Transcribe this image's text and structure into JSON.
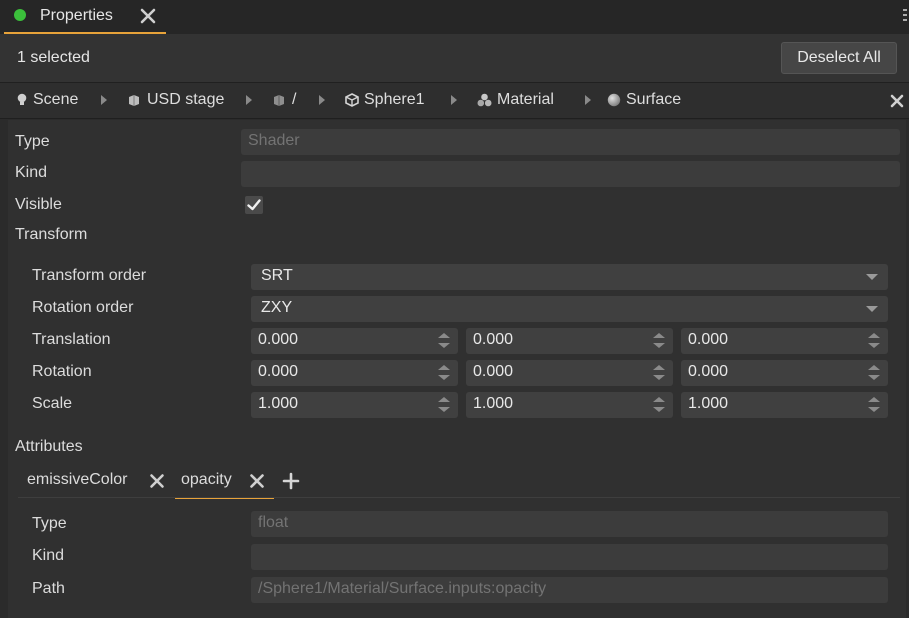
{
  "panel_tab": {
    "title": "Properties",
    "status_color": "#3bbf3b"
  },
  "selection": {
    "count_label": "1 selected",
    "deselect_label": "Deselect All"
  },
  "breadcrumb": [
    {
      "label": "Scene",
      "icon": "bulb-icon"
    },
    {
      "label": "USD stage",
      "icon": "cube-stack-icon"
    },
    {
      "label": "/",
      "icon": "cube-stack-icon"
    },
    {
      "label": "Sphere1",
      "icon": "cube-icon"
    },
    {
      "label": "Material",
      "icon": "material-icon"
    },
    {
      "label": "Surface",
      "icon": "sphere-icon"
    }
  ],
  "props": {
    "type_label": "Type",
    "type_placeholder": "Shader",
    "kind_label": "Kind",
    "kind_value": "",
    "visible_label": "Visible",
    "visible_checked": true,
    "transform_label": "Transform"
  },
  "transform": {
    "order_label": "Transform order",
    "order_value": "SRT",
    "rotation_order_label": "Rotation order",
    "rotation_order_value": "ZXY",
    "translation_label": "Translation",
    "translation": [
      "0.000",
      "0.000",
      "0.000"
    ],
    "rotation_label": "Rotation",
    "rotation": [
      "0.000",
      "0.000",
      "0.000"
    ],
    "scale_label": "Scale",
    "scale": [
      "1.000",
      "1.000",
      "1.000"
    ]
  },
  "attributes": {
    "section_label": "Attributes",
    "tabs": [
      {
        "label": "emissiveColor",
        "active": false
      },
      {
        "label": "opacity",
        "active": true
      }
    ],
    "type_label": "Type",
    "type_placeholder": "float",
    "kind_label": "Kind",
    "kind_value": "",
    "path_label": "Path",
    "path_placeholder": "/Sphere1/Material/Surface.inputs:opacity"
  },
  "colors": {
    "accent": "#e8a33a",
    "background": "#2b2b2b",
    "panel": "#303030"
  }
}
